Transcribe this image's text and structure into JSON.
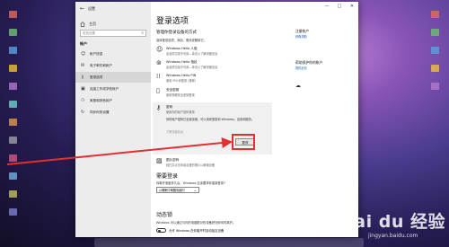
{
  "desktop": {
    "colors": [
      "#e36a5c",
      "#6fbf73",
      "#5aa0e0",
      "#f0c040",
      "#b07ad0",
      "#6fd0d0",
      "#e09a50",
      "#9aa0a8",
      "#d05a8a",
      "#70b0e0",
      "#c0c060",
      "#8080d0"
    ]
  },
  "window": {
    "app_title": "设置",
    "back_icon": "back-arrow-icon",
    "controls": [
      "—",
      "□",
      "✕"
    ]
  },
  "sidebar": {
    "home_label": "主页",
    "search_placeholder": "查找设置",
    "section": "帐户",
    "items": [
      {
        "icon": "person-icon",
        "label": "帐户信息",
        "active": false
      },
      {
        "icon": "mail-icon",
        "label": "电子邮件和帐户",
        "active": false
      },
      {
        "icon": "key-icon",
        "label": "登录选项",
        "active": true
      },
      {
        "icon": "briefcase-icon",
        "label": "连接工作或学校帐户",
        "active": false
      },
      {
        "icon": "family-icon",
        "label": "家庭和其他用户",
        "active": false
      },
      {
        "icon": "sync-icon",
        "label": "同步你的设置",
        "active": false
      }
    ]
  },
  "main": {
    "title": "登录选项",
    "subtitle": "管理你登录设备的方式",
    "select_prompt": "选择登录选项，添加、更改或删除它。",
    "options": [
      {
        "icon": "face-icon",
        "title": "Windows Hello 人脸",
        "desc": "此选项当前不可用—单击以了解详细信息"
      },
      {
        "icon": "fingerprint-icon",
        "title": "Windows Hello 指纹",
        "desc": "此选项当前不可用—单击以了解详细信息"
      },
      {
        "icon": "keypad-icon",
        "title": "Windows Hello PIN",
        "desc": "使用 PIN 码登录 (推荐)"
      },
      {
        "icon": "usb-key-icon",
        "title": "安全密钥",
        "desc": "使用物理安全密钥登录"
      }
    ],
    "password": {
      "icon": "key-icon",
      "title": "密码",
      "desc": "使用你的帐户密码登录",
      "detail": "你的帐户密码已全部设置，可以用来登录到 Windows、应用和服务。",
      "link": "了解详细信息",
      "button": "更改"
    },
    "picture_password": {
      "icon": "picture-icon",
      "title": "图片密码",
      "desc": "轻扫并点击你最喜爱的照片以解锁设备"
    },
    "require_heading": "需要登录",
    "require_text": "你离开电脑多久后，Windows 应该要求你重新登录?",
    "require_value": "从睡眠中唤醒电脑时",
    "dynamic_lock_heading": "动态锁",
    "dynamic_lock_text": "Windows 可以通过与你的电脑配对的设备获知你何时离开。",
    "dynamic_lock_toggle": "允许 Windows 在你离开时自动锁定设备"
  },
  "right_column": {
    "related_title": "注册帐户",
    "related_link": "获取帮助",
    "help_title": "帮助保护你的帐户",
    "help_link": "提供反馈",
    "feedback_icon": "feedback-icon"
  },
  "watermark": {
    "logo": "Bai du 经验",
    "url": "jingyan.baidu.com"
  },
  "colors": {
    "annotation_red": "#e03030",
    "sidebar_bg": "#ececec",
    "link_blue": "#0a5fb0"
  }
}
